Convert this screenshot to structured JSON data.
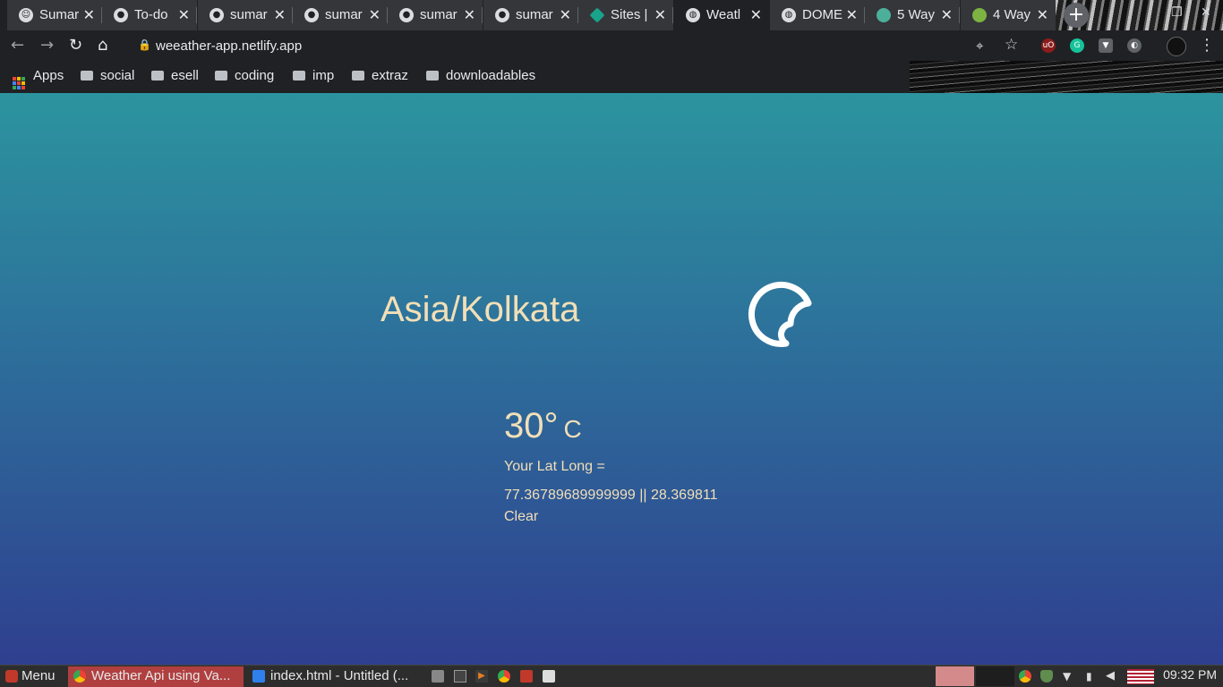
{
  "browser": {
    "tabs": [
      {
        "title": "Sumar",
        "icon": "person-icon"
      },
      {
        "title": "To-do",
        "icon": "github-icon"
      },
      {
        "title": "sumar",
        "icon": "github-icon"
      },
      {
        "title": "sumar",
        "icon": "github-icon"
      },
      {
        "title": "sumar",
        "icon": "github-icon"
      },
      {
        "title": "sumar",
        "icon": "github-icon"
      },
      {
        "title": "Sites |",
        "icon": "sites-icon"
      },
      {
        "title": "Weatl",
        "icon": "globe-icon",
        "active": true
      },
      {
        "title": "DOME",
        "icon": "globe-icon"
      },
      {
        "title": "5 Way",
        "icon": "site-icon"
      },
      {
        "title": "4 Way",
        "icon": "site-icon"
      }
    ],
    "url": "weeather-app.netlify.app",
    "bookmarks": [
      "Apps",
      "social",
      "esell",
      "coding",
      "imp",
      "extraz",
      "downloadables"
    ]
  },
  "weather": {
    "timezone": "Asia/Kolkata",
    "temperature": "30°",
    "unit": "C",
    "latlong_label": "Your Lat Long =",
    "latlong_value": "77.36789689999999 || 28.369811",
    "summary": "Clear",
    "icon": "clear-night-moon-icon"
  },
  "taskbar": {
    "menu": "Menu",
    "windows": [
      "Weather Api using Va...",
      "index.html - Untitled (..."
    ],
    "clock": "09:32 PM"
  },
  "colors": {
    "page_top": "#2c949e",
    "page_bottom": "#2f3f8f",
    "text": "#f2dfb7"
  }
}
